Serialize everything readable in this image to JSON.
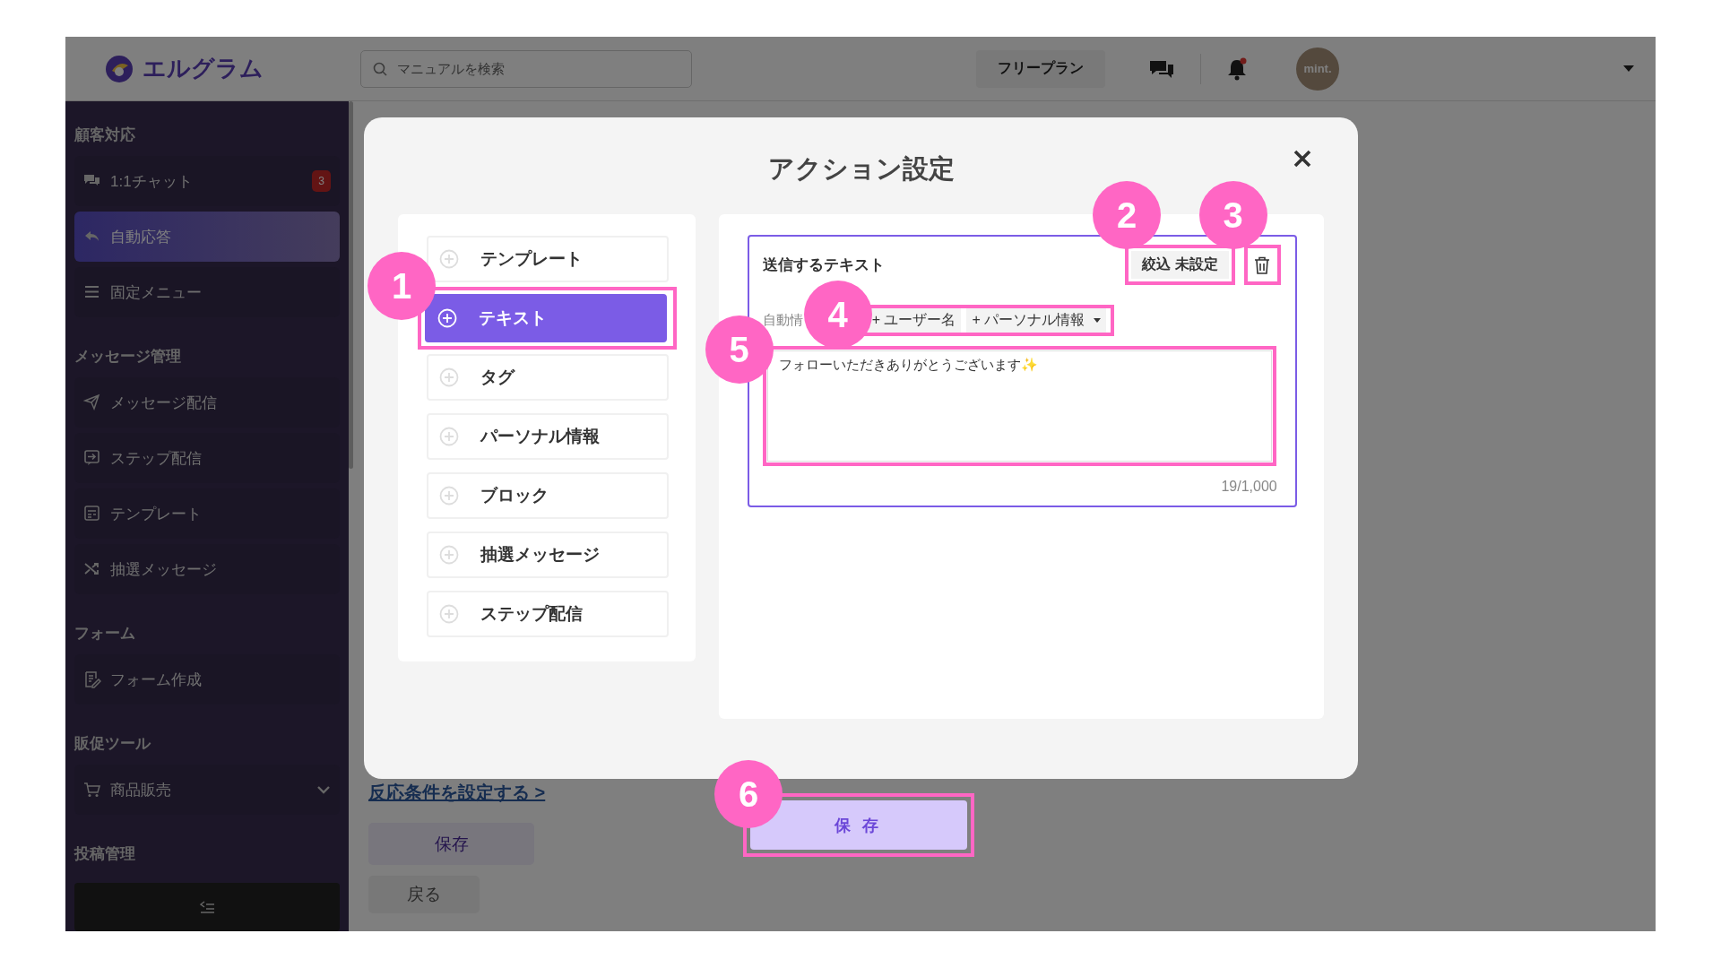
{
  "header": {
    "logo": "エルグラム",
    "search": {
      "placeholder": "マニュアルを検索"
    },
    "plan_button": "フリープラン",
    "avatar": "mint."
  },
  "sidebar": {
    "sections": [
      {
        "title": "顧客対応",
        "items": [
          {
            "label": "1:1チャット",
            "badge": "3",
            "selected": false
          },
          {
            "label": "自動応答",
            "selected": true
          },
          {
            "label": "固定メニュー",
            "selected": false
          }
        ]
      },
      {
        "title": "メッセージ管理",
        "items": [
          {
            "label": "メッセージ配信",
            "selected": false
          },
          {
            "label": "ステップ配信",
            "selected": false
          },
          {
            "label": "テンプレート",
            "selected": false
          },
          {
            "label": "抽選メッセージ",
            "selected": false
          }
        ]
      },
      {
        "title": "フォーム",
        "items": [
          {
            "label": "フォーム作成",
            "selected": false
          }
        ]
      },
      {
        "title": "販促ツール",
        "items": [
          {
            "label": "商品販売",
            "selected": false,
            "expanded": false
          }
        ]
      },
      {
        "title": "投稿管理"
      }
    ]
  },
  "background_page": {
    "link": "反応条件を設定する >",
    "buttons": [
      "保存",
      "戻る"
    ]
  },
  "modal": {
    "title": "アクション設定",
    "action_types": [
      {
        "label": "テンプレート",
        "selected": false
      },
      {
        "label": "テキスト",
        "selected": true,
        "callout": "1"
      },
      {
        "label": "タグ",
        "selected": false
      },
      {
        "label": "パーソナル情報",
        "selected": false
      },
      {
        "label": "ブロック",
        "selected": false
      },
      {
        "label": "抽選メッセージ",
        "selected": false
      },
      {
        "label": "ステップ配信",
        "selected": false
      }
    ],
    "card": {
      "title": "送信するテキスト",
      "filter_button": {
        "label": "絞込 未設定",
        "callout": "2"
      },
      "delete_button": {
        "callout": "3"
      },
      "insert": {
        "label": "自動情",
        "buttons": [
          "+ ユーザー名",
          "+ パーソナル情報"
        ],
        "callout": "4"
      },
      "message": {
        "value": "フォローいただきありがとうございます✨",
        "callout": "5"
      },
      "counter": "19/1,000"
    },
    "save_button": {
      "label": "保 存",
      "callout": "6"
    }
  }
}
